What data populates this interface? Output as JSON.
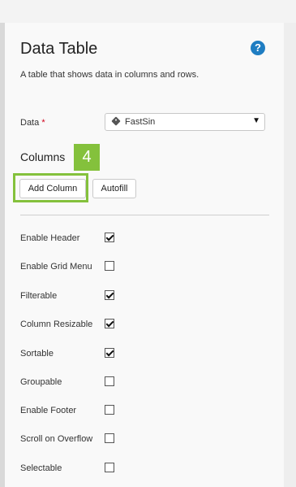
{
  "panel": {
    "title": "Data Table",
    "description": "A table that shows data in columns and rows."
  },
  "data_field": {
    "label": "Data",
    "required_mark": "*",
    "value": "FastSin",
    "value_icon": "tag-icon",
    "dropdown_icon": "▼"
  },
  "columns": {
    "heading": "Columns",
    "step_badge": "4",
    "add_column_label": "Add Column",
    "autofill_label": "Autofill"
  },
  "options": [
    {
      "label": "Enable Header",
      "checked": true
    },
    {
      "label": "Enable Grid Menu",
      "checked": false
    },
    {
      "label": "Filterable",
      "checked": true
    },
    {
      "label": "Column Resizable",
      "checked": true
    },
    {
      "label": "Sortable",
      "checked": true
    },
    {
      "label": "Groupable",
      "checked": false
    },
    {
      "label": "Enable Footer",
      "checked": false
    },
    {
      "label": "Scroll on Overflow",
      "checked": false
    },
    {
      "label": "Selectable",
      "checked": false
    }
  ],
  "help_icon": "?",
  "colors": {
    "accent_green": "#84c13c",
    "help_blue": "#1f7dc2",
    "required_red": "#d0021b"
  }
}
